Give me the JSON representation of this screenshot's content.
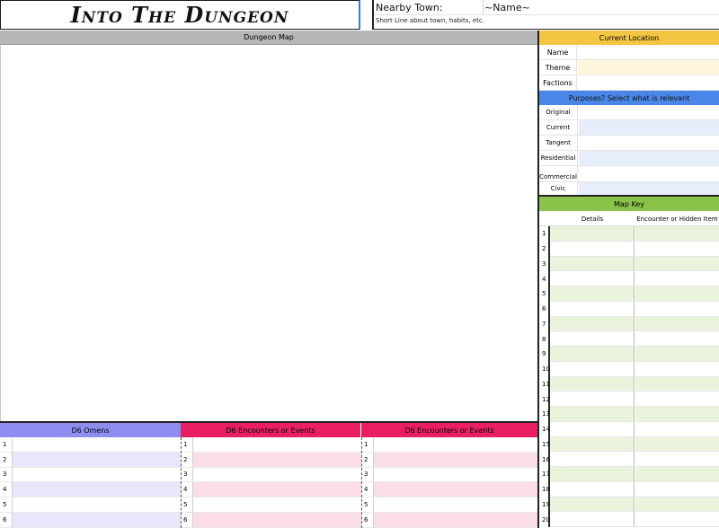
{
  "header": {
    "title": "Into The Dungeon",
    "nearby_town_label": "Nearby Town:",
    "town_name": "~Name~",
    "short_line": "Short Line about town, habits, etc."
  },
  "map": {
    "header": "Dungeon Map"
  },
  "current_location": {
    "header": "Current Location",
    "fields": [
      {
        "label": "Name",
        "value": ""
      },
      {
        "label": "Theme",
        "value": ""
      },
      {
        "label": "Factions",
        "value": ""
      }
    ]
  },
  "purposes": {
    "header": "Purposes? Select what is relevant",
    "items": [
      {
        "label": "Original"
      },
      {
        "label": "Current"
      },
      {
        "label": "Tangent"
      },
      {
        "label": "Residential"
      },
      {
        "label": "Commercial"
      },
      {
        "label": "Civic"
      }
    ]
  },
  "map_key": {
    "header": "Map Key",
    "col_details": "Details",
    "col_encounter": "Encounter or Hidden Item",
    "rows": [
      "1",
      "2",
      "3",
      "4",
      "5",
      "6",
      "7",
      "8",
      "9",
      "10",
      "11",
      "12",
      "13",
      "14",
      "15",
      "16",
      "17",
      "18",
      "19",
      "20"
    ]
  },
  "tables": {
    "omens": {
      "header": "D6 Omens",
      "rows": [
        "1",
        "2",
        "3",
        "4",
        "5",
        "6"
      ]
    },
    "encounters_1": {
      "header": "D6 Encounters or Events",
      "rows": [
        "1",
        "2",
        "3",
        "4",
        "5",
        "6"
      ]
    },
    "encounters_2": {
      "header": "D6 Encounters or Events",
      "rows": [
        "1",
        "2",
        "3",
        "4",
        "5",
        "6"
      ]
    }
  },
  "colors": {
    "current_location": "#f4c542",
    "purposes": "#4a86e8",
    "map_key": "#8bc34a",
    "omens": "#8e8ef0",
    "encounters": "#e91e63",
    "map_header": "#b7b7b7"
  }
}
